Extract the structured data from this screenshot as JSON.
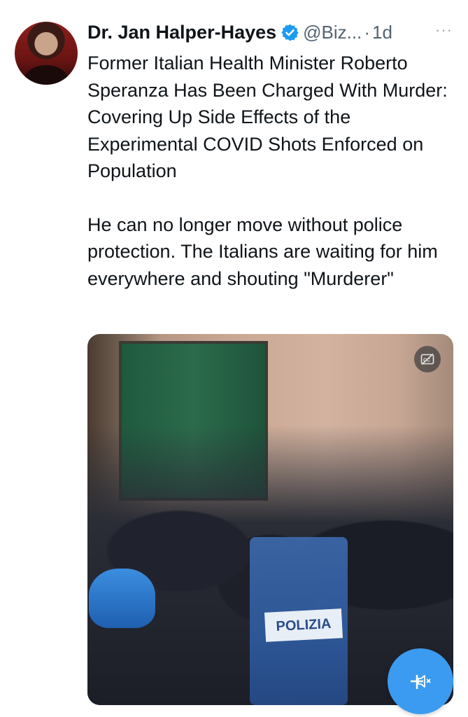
{
  "tweet": {
    "author_name": "Dr. Jan Halper-Hayes",
    "handle": "@Biz...",
    "separator": "·",
    "time": "1d",
    "more_label": "···",
    "paragraphs": [
      "Former Italian Health Minister Roberto Speranza Has Been Charged With Murder: Covering Up Side Effects of the Experimental COVID Shots Enforced on Population",
      "He can no longer move without police protection.  The Italians are waiting for him everywhere and shouting \"Murderer\""
    ]
  },
  "media": {
    "type": "video",
    "shield_text": "POLIZIA",
    "cc_icon": "captions-off-icon",
    "mute_icon": "speaker-muted-icon"
  },
  "colors": {
    "verified": "#1d9bf0",
    "mute_button": "#3b9bf0",
    "secondary_text": "#536471"
  }
}
